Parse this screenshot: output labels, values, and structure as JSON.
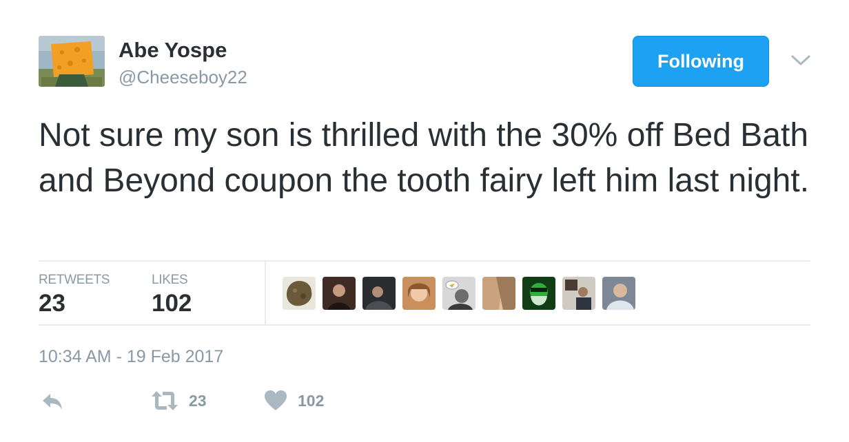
{
  "user": {
    "name": "Abe Yospe",
    "handle": "@Cheeseboy22",
    "avatar": "cheese-head-avatar"
  },
  "follow_button": {
    "label": "Following",
    "color": "#1da1f2"
  },
  "menu": {
    "icon": "chevron-down-icon"
  },
  "tweet": {
    "text": "Not sure my son is thrilled with the 30% off Bed Bath and Beyond coupon the tooth fairy left him last night."
  },
  "stats": {
    "retweets_label": "RETWEETS",
    "retweets_value": "23",
    "likes_label": "LIKES",
    "likes_value": "102"
  },
  "likers": [
    {
      "icon": "user-avatar-1",
      "color": "#6b5a3a"
    },
    {
      "icon": "user-avatar-2",
      "color": "#3f2a24"
    },
    {
      "icon": "user-avatar-3",
      "color": "#2a2c30"
    },
    {
      "icon": "user-avatar-4",
      "color": "#c98f5d"
    },
    {
      "icon": "user-avatar-5",
      "color": "#6d6d6d"
    },
    {
      "icon": "user-avatar-6",
      "color": "#caa27e"
    },
    {
      "icon": "user-avatar-7",
      "color": "#1f8a2a"
    },
    {
      "icon": "user-avatar-8",
      "color": "#a6a097"
    },
    {
      "icon": "user-avatar-9",
      "color": "#7e8796"
    }
  ],
  "timestamp": "10:34 AM - 19 Feb 2017",
  "actions": {
    "reply_icon": "reply-icon",
    "retweet_icon": "retweet-icon",
    "retweet_count": "23",
    "like_icon": "heart-icon",
    "like_count": "102"
  },
  "colors": {
    "text": "#292f33",
    "muted": "#8899a6",
    "divider": "#e6ecf0",
    "accent": "#1da1f2"
  }
}
